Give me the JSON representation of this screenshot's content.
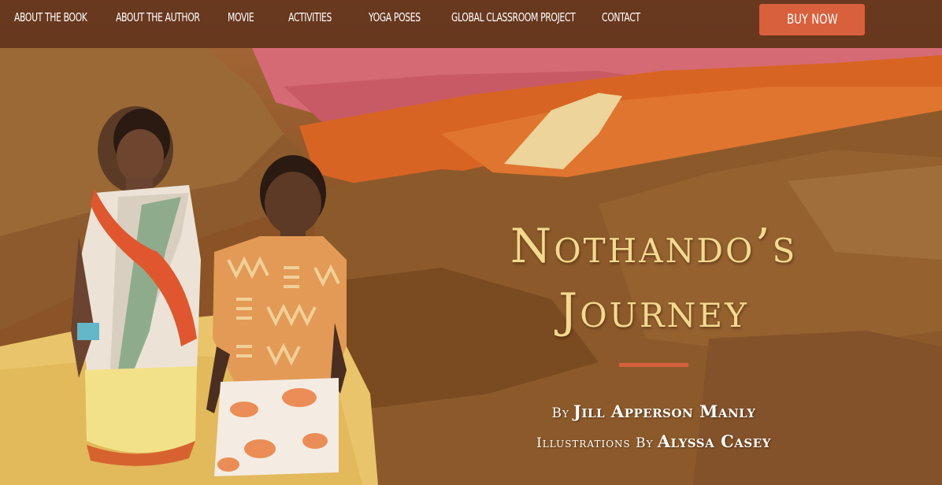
{
  "nav": {
    "items": [
      {
        "label": "About the Book"
      },
      {
        "label": "About the Author"
      },
      {
        "label": "Movie"
      },
      {
        "label": "Activities"
      },
      {
        "label": "Yoga Poses"
      },
      {
        "label": "Global Classroom Project"
      },
      {
        "label": "Contact"
      }
    ],
    "buy_label": "BUY NOW"
  },
  "hero": {
    "title_line1": "Nothando’s",
    "title_line2": "Journey",
    "author_prefix": "By",
    "author_name": "Jill Apperson Manly",
    "illustrator_prefix": "Illustrations By",
    "illustrator_name": "Alyssa Casey",
    "illustration": "collage-illustration-two-children-walking",
    "colors": {
      "accent": "#d9603c",
      "title": "#f3d98f",
      "nav_bg": "#50261680"
    }
  }
}
